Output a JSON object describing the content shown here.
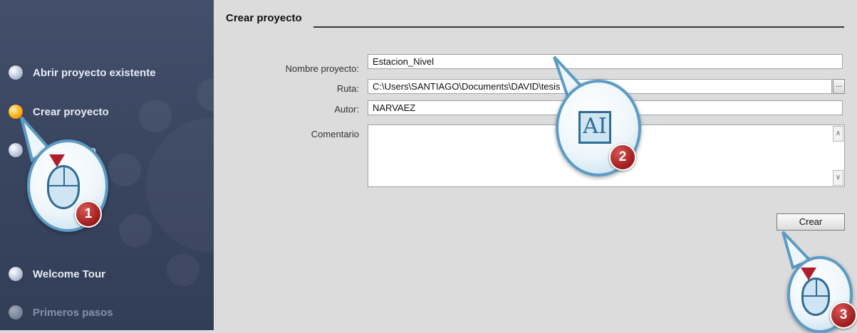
{
  "sidebar": {
    "items": [
      {
        "label": "Abrir proyecto existente",
        "state": "normal"
      },
      {
        "label": "Crear proyecto",
        "state": "active"
      },
      {
        "label": "ecto",
        "state": "partially-obscured"
      },
      {
        "label": "Welcome Tour",
        "state": "normal"
      },
      {
        "label": "Primeros pasos",
        "state": "disabled"
      }
    ]
  },
  "main": {
    "title": "Crear proyecto",
    "fields": {
      "nombre": {
        "label": "Nombre proyecto:",
        "value": "Estacion_Nivel"
      },
      "ruta": {
        "label": "Ruta:",
        "value": "C:\\Users\\SANTIAGO\\Documents\\DAVID\\tesis",
        "browse_label": "..."
      },
      "autor": {
        "label": "Autor:",
        "value": "NARVAEZ"
      },
      "comentario": {
        "label": "Comentario",
        "value": ""
      }
    },
    "create_button": "Crear"
  },
  "callouts": [
    {
      "step": "1",
      "icon": "mouse-click-icon"
    },
    {
      "step": "2",
      "icon": "text-input-icon",
      "glyph": "AI"
    },
    {
      "step": "3",
      "icon": "mouse-click-icon"
    }
  ],
  "colors": {
    "sidebar_bg": "#3a4660",
    "active_dot": "#ffb11a",
    "badge": "#9c1b1b",
    "callout_border": "#5b9bc4"
  }
}
